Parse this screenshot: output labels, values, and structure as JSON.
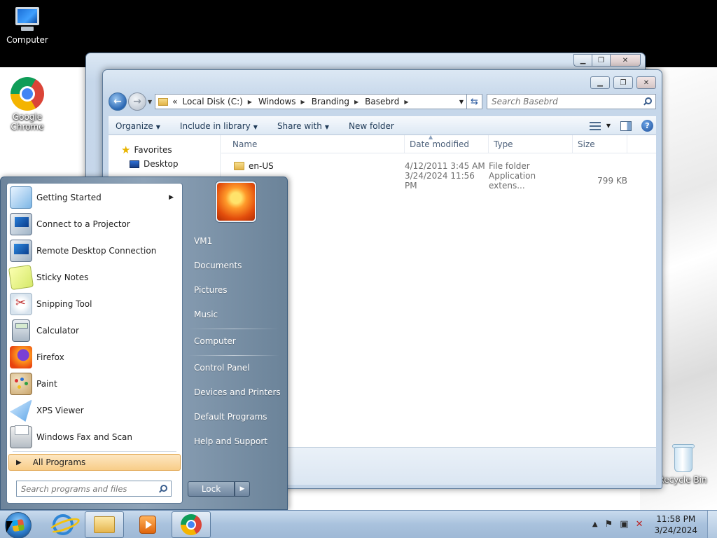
{
  "desktop": {
    "icons": [
      {
        "label": "Computer"
      },
      {
        "label": "Google Chrome"
      },
      {
        "label": "Recycle Bin"
      }
    ]
  },
  "explorer": {
    "address": {
      "prefix": "«",
      "crumbs": [
        "Local Disk (C:)",
        "Windows",
        "Branding",
        "Basebrd"
      ]
    },
    "search_placeholder": "Search Basebrd",
    "commands": [
      "Organize",
      "Include in library",
      "Share with",
      "New folder"
    ],
    "nav_pane": [
      {
        "label": "Favorites",
        "icon": "star-icon"
      },
      {
        "label": "Desktop",
        "icon": "desktop-icon"
      }
    ],
    "columns": [
      "Name",
      "Date modified",
      "Type",
      "Size"
    ],
    "files": [
      {
        "name": "en-US",
        "date": "4/12/2011 3:45 AM",
        "type": "File folder",
        "size": ""
      },
      {
        "name": "",
        "date": "3/24/2024 11:56 PM",
        "type": "Application extens...",
        "size": "799 KB"
      }
    ]
  },
  "start_menu": {
    "programs": [
      {
        "label": "Getting Started",
        "icon": "getting-started-icon",
        "submenu": true
      },
      {
        "label": "Connect to a Projector",
        "icon": "projector-icon"
      },
      {
        "label": "Remote Desktop Connection",
        "icon": "remote-desktop-icon"
      },
      {
        "label": "Sticky Notes",
        "icon": "sticky-notes-icon"
      },
      {
        "label": "Snipping Tool",
        "icon": "snipping-tool-icon"
      },
      {
        "label": "Calculator",
        "icon": "calculator-icon"
      },
      {
        "label": "Firefox",
        "icon": "firefox-icon"
      },
      {
        "label": "Paint",
        "icon": "paint-icon"
      },
      {
        "label": "XPS Viewer",
        "icon": "xps-viewer-icon"
      },
      {
        "label": "Windows Fax and Scan",
        "icon": "fax-scan-icon"
      }
    ],
    "all_programs": "All Programs",
    "search_placeholder": "Search programs and files",
    "places": [
      "VM1",
      "Documents",
      "Pictures",
      "Music",
      "Computer",
      "Control Panel",
      "Devices and Printers",
      "Default Programs",
      "Help and Support"
    ],
    "lock_label": "Lock"
  },
  "taskbar": {
    "pinned": [
      "internet-explorer-icon",
      "windows-explorer-icon",
      "media-player-icon",
      "chrome-icon"
    ],
    "time": "11:58 PM",
    "date": "3/24/2024"
  }
}
